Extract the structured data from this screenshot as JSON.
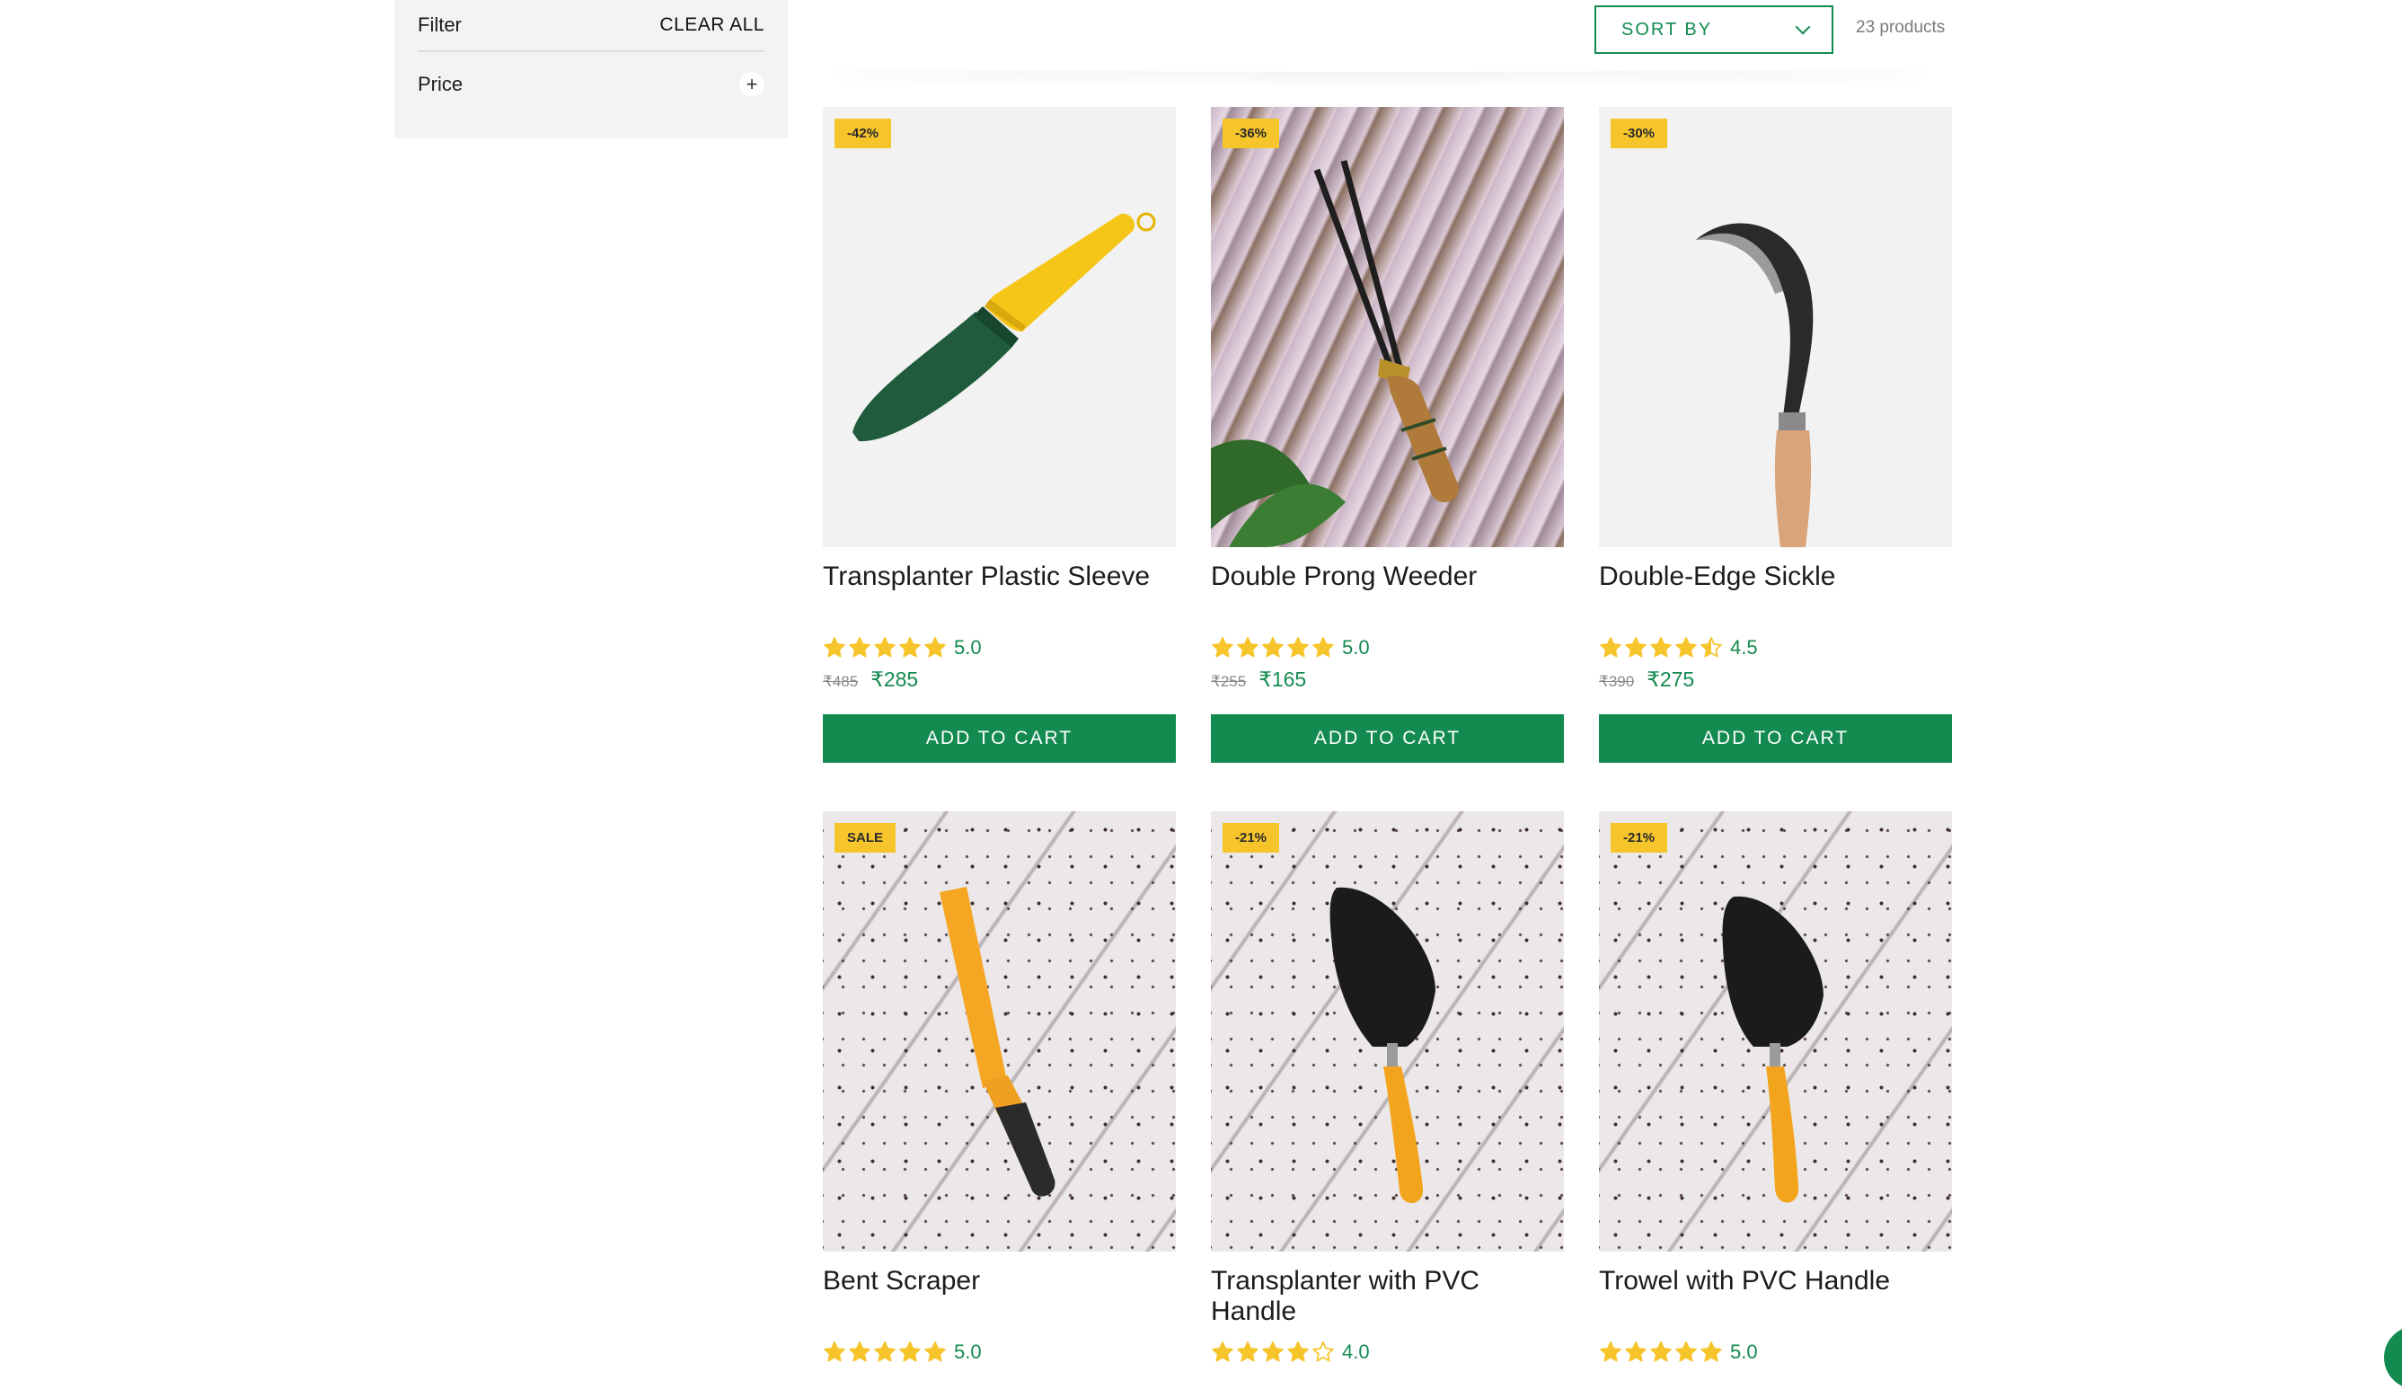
{
  "filter": {
    "title": "Filter",
    "clear_all": "CLEAR ALL",
    "price_label": "Price",
    "expand_symbol": "+"
  },
  "toolbar": {
    "sort_label": "SORT BY",
    "product_count": "23 products"
  },
  "colors": {
    "accent": "#138a4f",
    "badge": "#f6c52b",
    "star": "#f6c52b"
  },
  "products": [
    {
      "badge": "-42%",
      "name": "Transplanter Plastic Sleeve",
      "rating": 5.0,
      "rating_text": "5.0",
      "old_price": "₹485",
      "price": "₹285",
      "cta": "ADD TO CART",
      "image": "green-trowel-yellow-handle"
    },
    {
      "badge": "-36%",
      "name": "Double Prong Weeder",
      "rating": 5.0,
      "rating_text": "5.0",
      "old_price": "₹255",
      "price": "₹165",
      "cta": "ADD TO CART",
      "image": "two-prong-weeder-wood-handle"
    },
    {
      "badge": "-30%",
      "name": "Double-Edge Sickle",
      "rating": 4.5,
      "rating_text": "4.5",
      "old_price": "₹390",
      "price": "₹275",
      "cta": "ADD TO CART",
      "image": "sickle-wood-handle"
    },
    {
      "badge": "SALE",
      "name": "Bent Scraper",
      "rating": 5.0,
      "rating_text": "5.0",
      "old_price": "",
      "price": "",
      "cta": "",
      "image": "yellow-scraper"
    },
    {
      "badge": "-21%",
      "name": "Transplanter with PVC Handle",
      "rating": 4.0,
      "rating_text": "4.0",
      "old_price": "",
      "price": "",
      "cta": "",
      "image": "black-trowel-yellow-handle"
    },
    {
      "badge": "-21%",
      "name": "Trowel with PVC Handle",
      "rating": 5.0,
      "rating_text": "5.0",
      "old_price": "",
      "price": "",
      "cta": "",
      "image": "black-trowel-yellow-handle"
    }
  ]
}
